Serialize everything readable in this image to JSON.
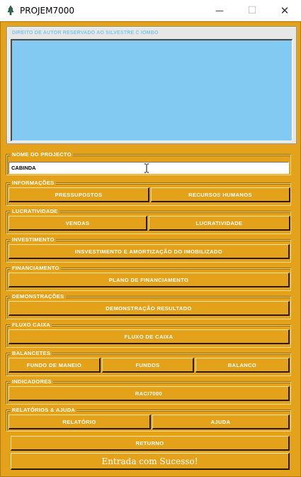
{
  "window": {
    "title": "PROJEM7000",
    "controls": {
      "minimize": "—",
      "maximize": "☐",
      "close": "✕"
    }
  },
  "banner": {
    "text": "DIREITO DE AUTOR RESERVADO AO SILVESTRE C IOMBO"
  },
  "project": {
    "label": "NOME DO PROJECTO",
    "value": "CABINDA"
  },
  "groups": {
    "informacoes": {
      "label": "INFORMAÇÕES",
      "buttons": [
        "PRESSUPOSTOS",
        "RECURSOS HUMANOS"
      ]
    },
    "lucratividade": {
      "label": "LUCRATIVIDADE",
      "buttons": [
        "VENDAS",
        "LUCRATIVIDADE"
      ]
    },
    "investimento": {
      "label": "INVESTIMENTO",
      "buttons": [
        "INSVESTIMENTO E AMORTIZAÇÃO DO IMOBILIZADO"
      ]
    },
    "financiamento": {
      "label": "FINANCIAMENTO",
      "buttons": [
        "PLANO DE FINANCIAMENTO"
      ]
    },
    "demonstracoes": {
      "label": "DEMONSTRAÇÕES",
      "buttons": [
        "DEMONSTRAÇÃO RESULTADO"
      ]
    },
    "fluxo": {
      "label": "FLUXO CAIXA",
      "buttons": [
        "FLUXO DE CAIXA"
      ]
    },
    "balancetes": {
      "label": "BALANCETES",
      "buttons": [
        "FUNDO DE MANEIO",
        "FUNDOS",
        "BALANCO"
      ]
    },
    "indicadores": {
      "label": "INDICADORES",
      "buttons": [
        "RACI7000"
      ]
    },
    "relatorios": {
      "label": "RELATÓRIOS & AJUDA",
      "buttons": [
        "RELATÓRIO",
        "AJUDA"
      ]
    }
  },
  "footer": {
    "return_label": "RETURNO",
    "status": "Entrada com Sucesso!"
  },
  "colors": {
    "panel": "#e3a21a",
    "display": "#82caf1",
    "banner_text": "#7fc6ec"
  }
}
